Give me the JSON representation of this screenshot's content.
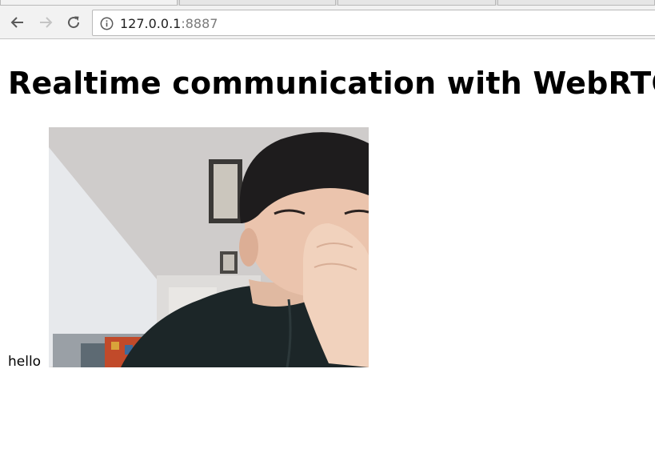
{
  "browser": {
    "address_host": "127.0.0.1",
    "address_port": ":8887",
    "icons": {
      "back": "back-arrow-icon",
      "forward": "forward-arrow-icon",
      "reload": "reload-icon",
      "site_info": "info-icon"
    }
  },
  "page": {
    "heading": "Realtime communication with WebRTC",
    "local_label": "hello"
  }
}
